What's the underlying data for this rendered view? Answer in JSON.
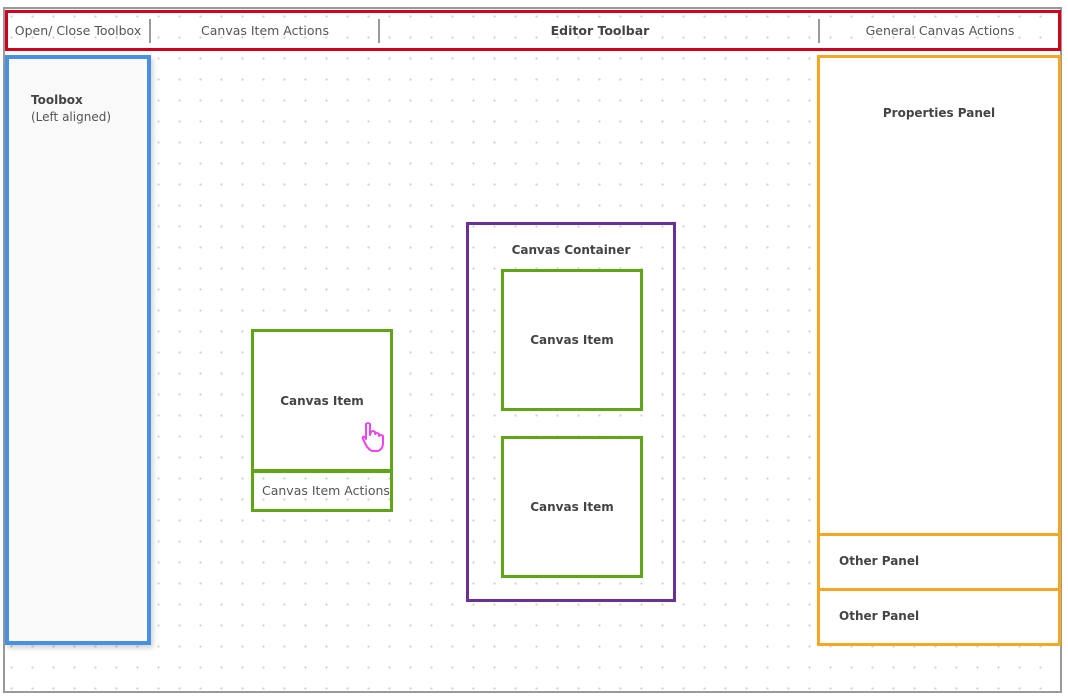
{
  "toolbar": {
    "open_close_toolbox": "Open/ Close Toolbox",
    "canvas_item_actions": "Canvas Item Actions",
    "editor_toolbar": "Editor Toolbar",
    "general_canvas_actions": "General Canvas Actions"
  },
  "toolbox": {
    "title": "Toolbox",
    "subtitle": "(Left aligned)"
  },
  "canvas": {
    "standalone_item": {
      "label": "Canvas Item",
      "actions_label": "Canvas Item Actions",
      "cursor_icon": "hand-pointer-icon"
    },
    "container": {
      "label": "Canvas Container",
      "items": [
        {
          "label": "Canvas Item"
        },
        {
          "label": "Canvas Item"
        }
      ]
    }
  },
  "properties_panel": {
    "label": "Properties Panel"
  },
  "other_panels": [
    {
      "label": "Other Panel"
    },
    {
      "label": "Other Panel"
    }
  ],
  "colors": {
    "toolbar_border": "#d0021b",
    "toolbox_border": "#4a90e2",
    "canvas_item_border": "#5fa515",
    "container_border": "#6b3096",
    "panel_border": "#f5a623",
    "cursor": "#ee44ee"
  }
}
